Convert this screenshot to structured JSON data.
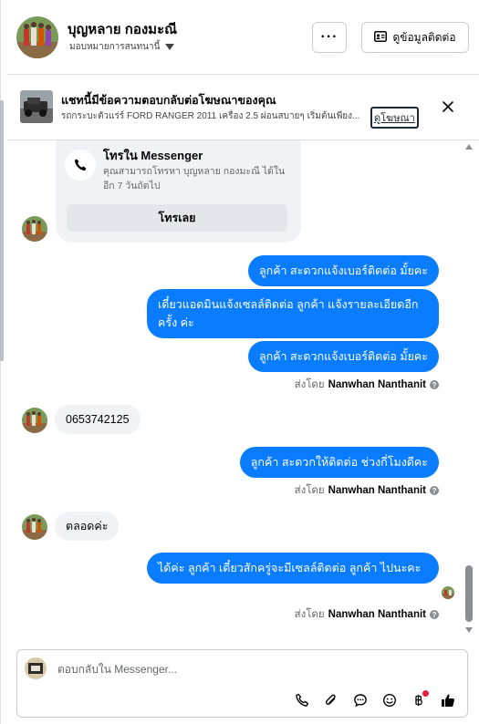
{
  "header": {
    "contact_name": "บุญหลาย กองมะณี",
    "assign_label": "มอบหมายการสนทนานี้",
    "more_label": "···",
    "contact_info_label": "ดูข้อมูลติดต่อ"
  },
  "ad_banner": {
    "title": "แชทนี้มีข้อความตอบกลับต่อโฆษณาของคุณ",
    "description": "รถกระบะตัวแร่ร์ FORD RANGER 2011 เครื่อง 2.5 ผ่อนสบายๆ เริ่มต้นเพียง...",
    "see_ad_label": "ดูโฆษณา"
  },
  "call_card": {
    "title": "โทรใน Messenger",
    "text": "คุณสามารถโทรหา บุญหลาย กองมะณี ได้ในอีก 7 วันถัดไป",
    "button_label": "โทรเลย"
  },
  "messages": [
    {
      "direction": "out",
      "text": "ลูกค้า สะดวกแจ้งเบอร์ติดต่อ มั้ยคะ"
    },
    {
      "direction": "out",
      "text": "เดี๋ยวแอดมินแจ้งเซลล์ติดต่อ ลูกค้า  แจ้งรายละเอียดอีกครั้ง ค่ะ"
    },
    {
      "direction": "out",
      "text": "ลูกค้า สะดวกแจ้งเบอร์ติดต่อ มั้ยคะ"
    },
    {
      "direction": "sent_by",
      "prefix": "ส่งโดย",
      "name": "Nanwhan Nanthanit"
    },
    {
      "direction": "in",
      "text": "0653742125"
    },
    {
      "direction": "out",
      "text": "ลูกค้า สะดวกให้ติดต่อ ช่วงกี่โมงดีคะ"
    },
    {
      "direction": "sent_by",
      "prefix": "ส่งโดย",
      "name": "Nanwhan Nanthanit"
    },
    {
      "direction": "in",
      "text": "ตลอดค่ะ"
    },
    {
      "direction": "out",
      "text": "ได้ค่ะ  ลูกค้า  เดี๋ยวสักครู่จะมีเซลล์ติดต่อ ลูกค้า ไปนะคะ"
    },
    {
      "direction": "sent_by",
      "prefix": "ส่งโดย",
      "name": "Nanwhan Nanthanit"
    }
  ],
  "composer": {
    "placeholder": "ตอบกลับใน Messenger...",
    "icons": [
      "phone-icon",
      "paperclip-icon",
      "saved-reply-icon",
      "emoji-icon",
      "baht-payment-icon",
      "thumbs-up-icon"
    ]
  },
  "colors": {
    "outgoing_bubble": "#0a7cff",
    "incoming_bubble": "#f0f2f5",
    "notification_dot": "#e41e3f"
  }
}
